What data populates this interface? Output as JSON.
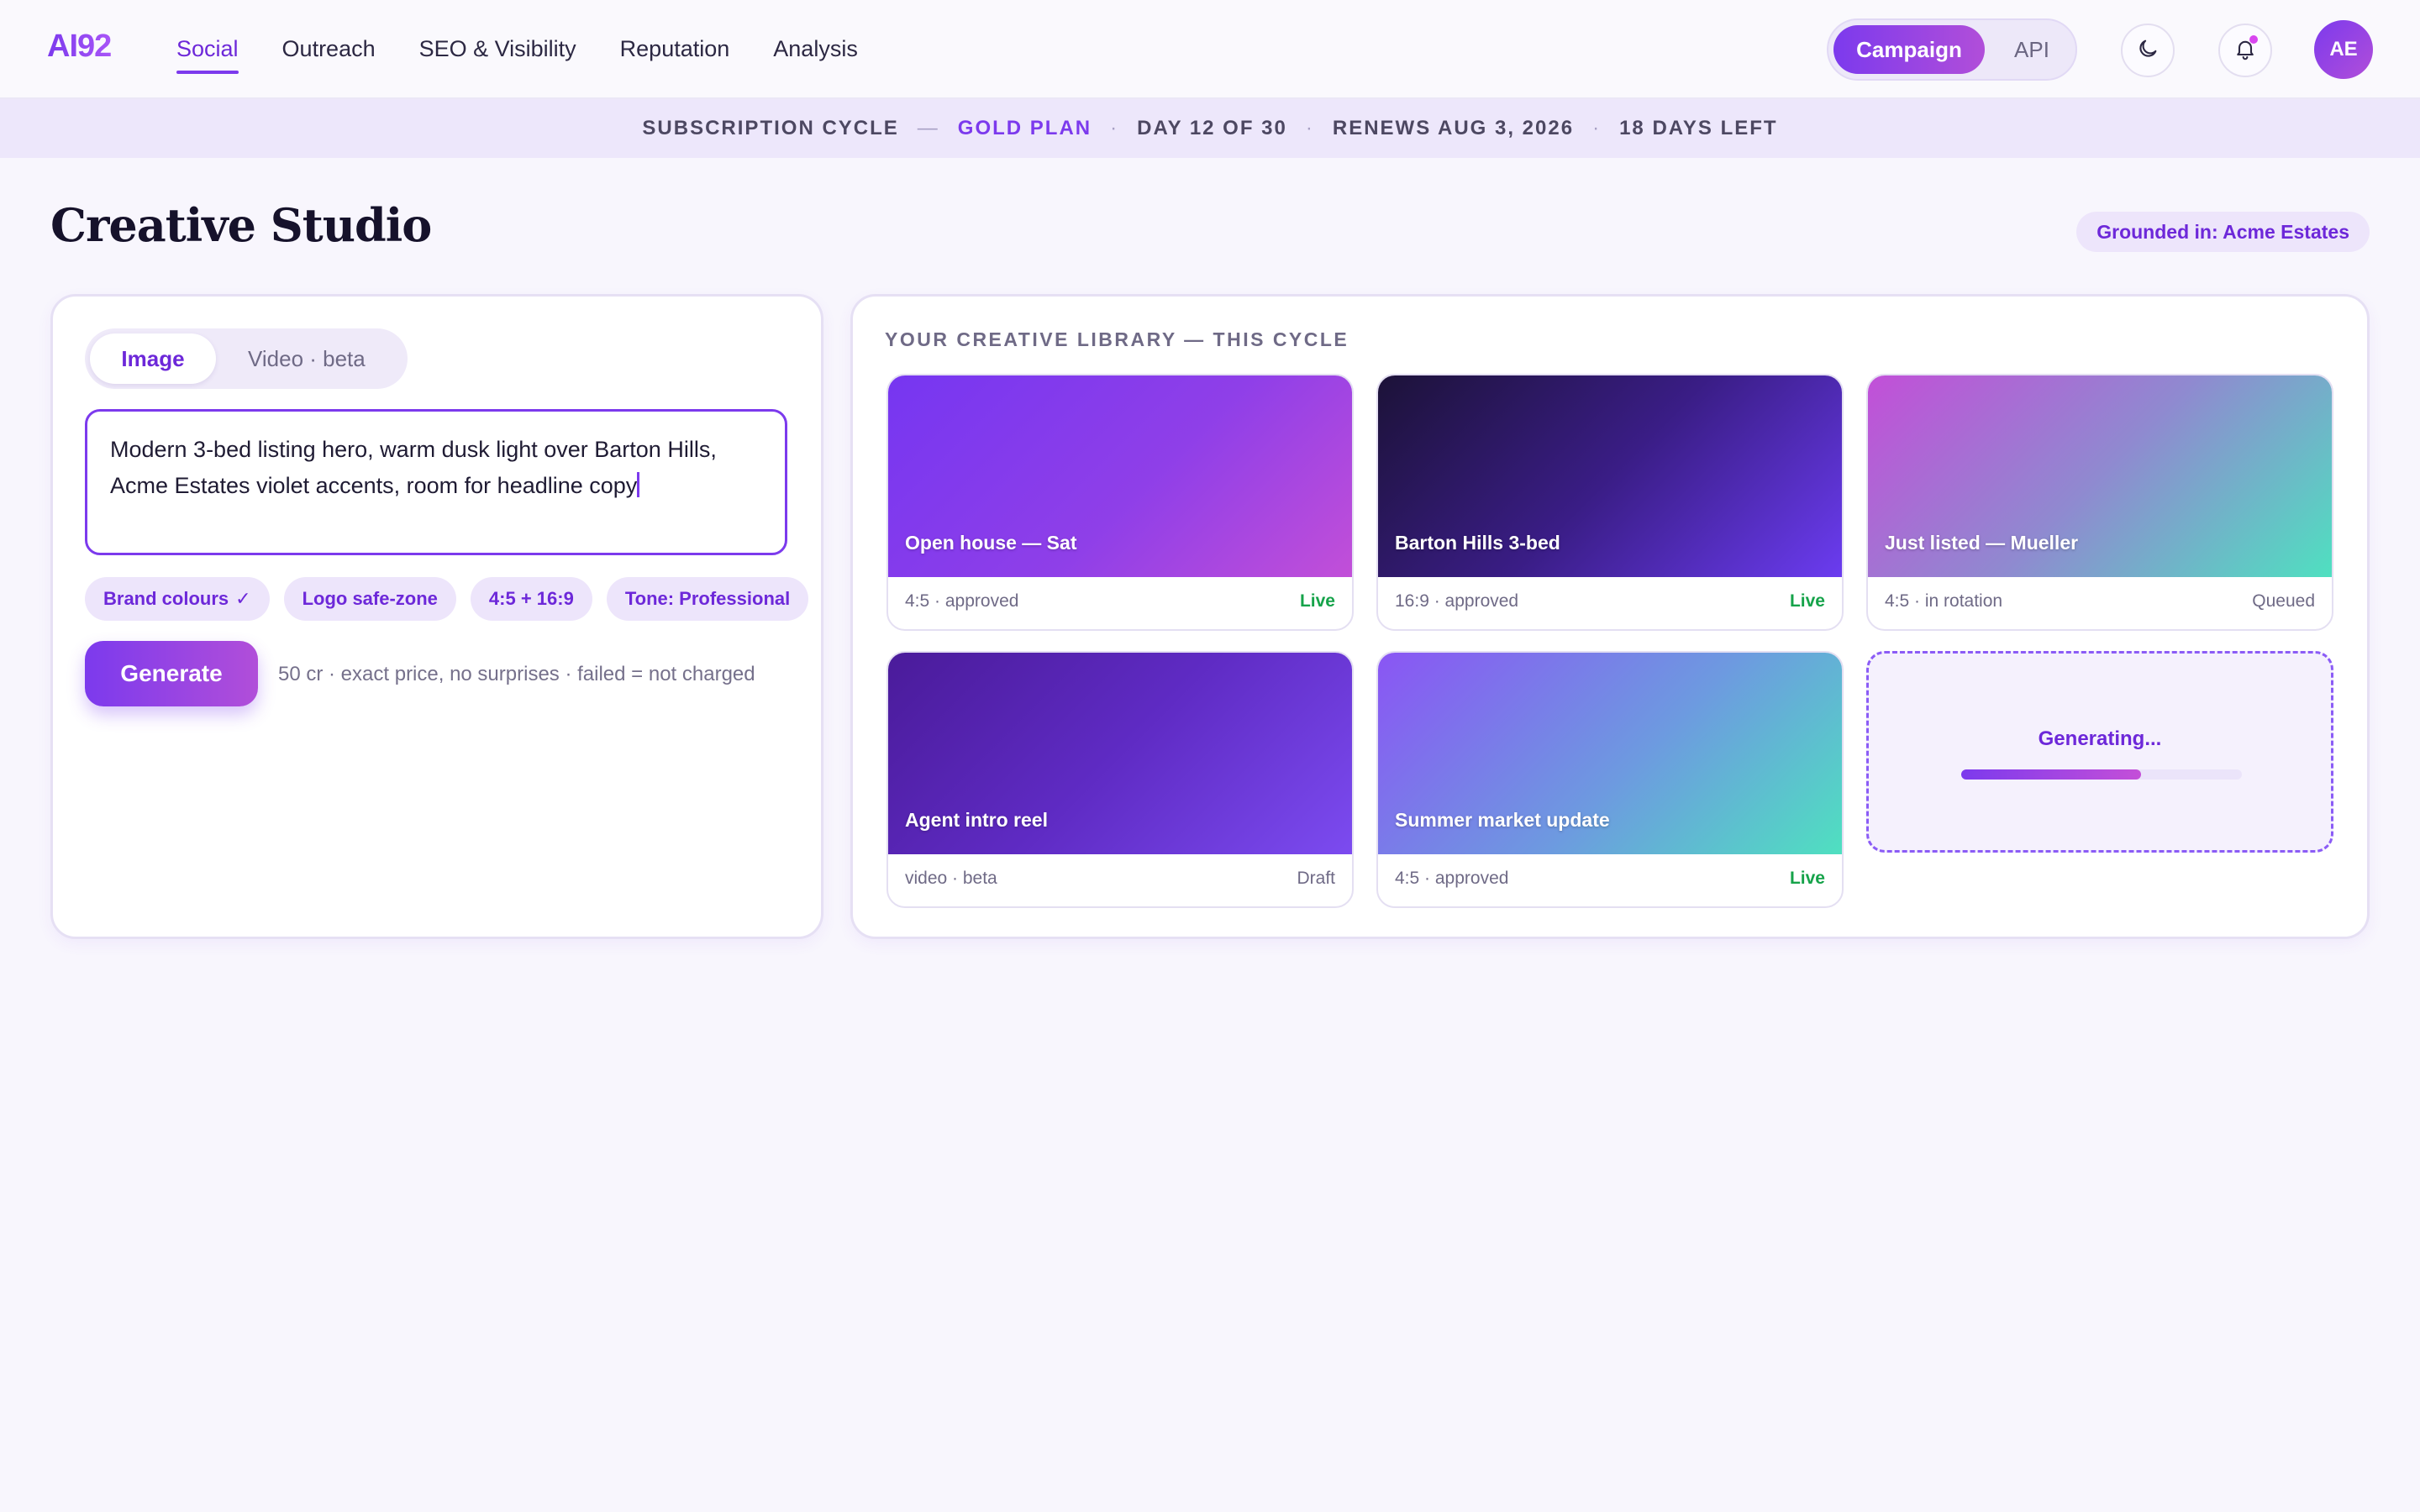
{
  "nav": {
    "logo": "AI92",
    "links": [
      "Social",
      "Outreach",
      "SEO & Visibility",
      "Reputation",
      "Analysis"
    ],
    "active_link": "Social",
    "mode_toggle": {
      "active": "Campaign",
      "inactive": "API"
    },
    "avatar_initials": "AE",
    "icons": [
      "moon-icon",
      "bell-icon"
    ]
  },
  "subscription": {
    "cycle_label": "SUBSCRIPTION CYCLE",
    "dash": "—",
    "plan": "GOLD PLAN",
    "day": "DAY 12 OF 30",
    "renews": "RENEWS AUG 3, 2026",
    "days_left": "18 DAYS LEFT"
  },
  "page": {
    "title": "Creative Studio",
    "grounded": "Grounded in: Acme Estates"
  },
  "composer": {
    "tabs": {
      "active": "Image",
      "inactive": "Video · beta"
    },
    "prompt": "Modern 3-bed listing hero, warm dusk light over Barton Hills, Acme Estates violet accents, room for headline copy",
    "chips": [
      "Brand colours",
      "Logo safe-zone",
      "4:5 + 16:9",
      "Tone: Professional"
    ],
    "chip_check": "✓",
    "generate_label": "Generate",
    "price_note": "50 cr · exact price, no surprises · failed = not charged"
  },
  "library": {
    "label": "YOUR CREATIVE LIBRARY — THIS CYCLE",
    "tiles": [
      {
        "title": "Open house — Sat",
        "meta": "4:5 · approved",
        "status": "Live"
      },
      {
        "title": "Barton Hills 3-bed",
        "meta": "16:9 · approved",
        "status": "Live"
      },
      {
        "title": "Just listed — Mueller",
        "meta": "4:5 · in rotation",
        "status": "Queued"
      },
      {
        "title": "Agent intro reel",
        "meta": "video · beta",
        "status": "Draft"
      },
      {
        "title": "Summer market update",
        "meta": "4:5 · approved",
        "status": "Live"
      }
    ],
    "generating": {
      "label": "Generating...",
      "progress": 0.64
    }
  },
  "colors": {
    "accent": "#7c3aed",
    "live": "#16a34a",
    "background": "#f8f6fd"
  }
}
